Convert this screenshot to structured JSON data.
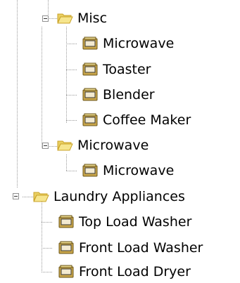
{
  "tree": {
    "misc": {
      "label": "Misc",
      "icon": "folder-open-icon",
      "children": [
        "Microwave",
        "Toaster",
        "Blender",
        "Coffee Maker"
      ]
    },
    "microwave_group": {
      "label": "Microwave",
      "icon": "folder-open-icon",
      "children": [
        "Microwave"
      ]
    },
    "laundry": {
      "label": "Laundry Appliances",
      "icon": "folder-open-icon",
      "children": [
        "Top Load Washer",
        "Front Load Washer",
        "Front Load Dryer"
      ]
    },
    "child_icon": "appliance-icon",
    "expander_icon": "minus-icon"
  },
  "colors": {
    "folder_fill": "#f6e58d",
    "folder_stroke": "#c9a227",
    "appliance_fill": "#c9a64a",
    "appliance_panel": "#f3ead0",
    "appliance_dark": "#3a3a3a",
    "connector": "#9a9a9a"
  }
}
